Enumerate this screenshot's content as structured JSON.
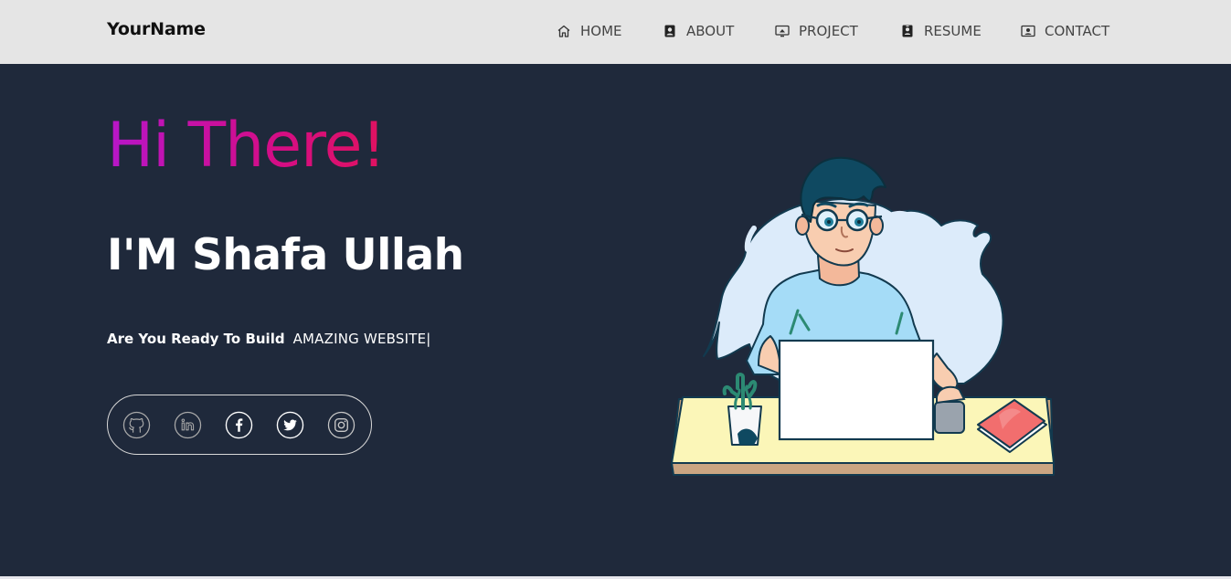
{
  "navbar": {
    "brand": "YourName",
    "items": [
      {
        "label": "HOME",
        "icon": "home-icon"
      },
      {
        "label": "ABOUT",
        "icon": "user-badge-icon"
      },
      {
        "label": "PROJECT",
        "icon": "monitor-icon"
      },
      {
        "label": "RESUME",
        "icon": "document-person-icon"
      },
      {
        "label": "CONTACT",
        "icon": "contact-card-icon"
      }
    ]
  },
  "hero": {
    "greeting": "Hi There!",
    "name": "I'M Shafa Ullah",
    "tagline_lead": "Are You Ready To Build",
    "tagline_typed": "AMAZING WEBSITE|",
    "social": [
      {
        "icon": "github-icon"
      },
      {
        "icon": "linkedin-icon"
      },
      {
        "icon": "facebook-icon"
      },
      {
        "icon": "twitter-icon"
      },
      {
        "icon": "instagram-icon"
      }
    ]
  },
  "colors": {
    "navbar_bg": "#e5e5e5",
    "hero_bg": "#1f293b",
    "greeting_gradient_start": "#b716c9",
    "greeting_gradient_end": "#e0125f"
  }
}
